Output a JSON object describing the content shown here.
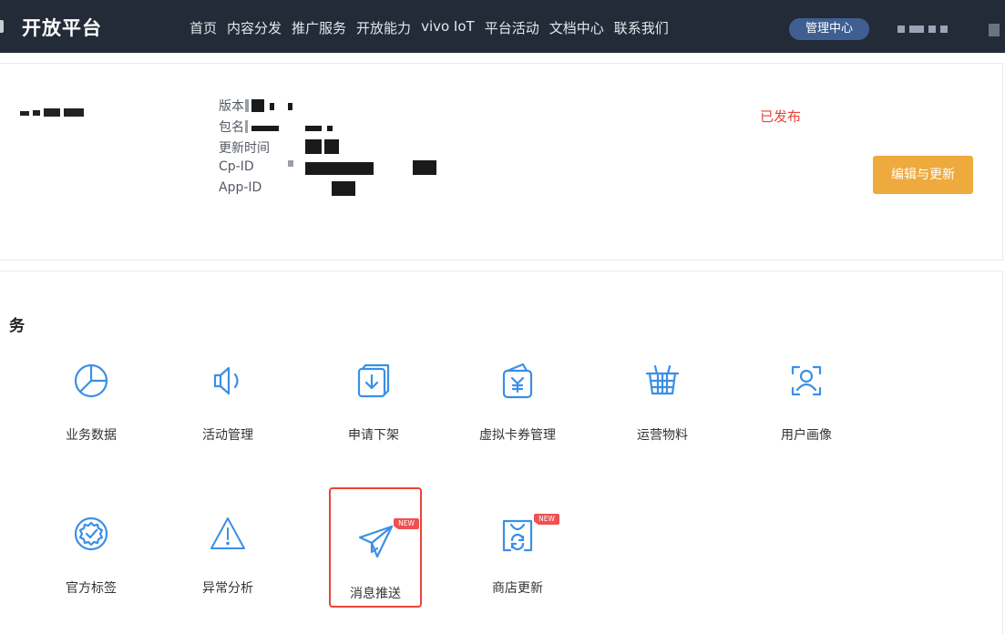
{
  "header": {
    "brand": "开放平台",
    "nav": [
      "首页",
      "内容分发",
      "推广服务",
      "开放能力",
      "vivo IoT",
      "平台活动",
      "文档中心",
      "联系我们"
    ],
    "management_button": "管理中心"
  },
  "app_info": {
    "fields": [
      {
        "label": "版本"
      },
      {
        "label": "包名"
      },
      {
        "label": "更新时间"
      },
      {
        "label": "Cp-ID"
      },
      {
        "label": "App-ID"
      }
    ],
    "status": "已发布",
    "edit_button": "编辑与更新"
  },
  "services": {
    "title": "务",
    "items": [
      {
        "label": "业务数据",
        "icon": "pie-chart-icon"
      },
      {
        "label": "活动管理",
        "icon": "speaker-icon"
      },
      {
        "label": "申请下架",
        "icon": "download-box-icon"
      },
      {
        "label": "虚拟卡券管理",
        "icon": "wallet-yen-icon"
      },
      {
        "label": "运营物料",
        "icon": "basket-icon"
      },
      {
        "label": "用户画像",
        "icon": "user-scan-icon"
      },
      {
        "label": "官方标签",
        "icon": "verified-badge-icon"
      },
      {
        "label": "异常分析",
        "icon": "warning-triangle-icon"
      },
      {
        "label": "消息推送",
        "icon": "paper-plane-icon",
        "badge": "NEW",
        "highlighted": true
      },
      {
        "label": "商店更新",
        "icon": "store-refresh-icon",
        "badge": "NEW"
      }
    ]
  },
  "colors": {
    "topbar": "#232b38",
    "accent_icon": "#3b8fe6",
    "status_red": "#e8443a",
    "edit_button": "#eeaa3c",
    "badge_new": "#ef5050"
  }
}
